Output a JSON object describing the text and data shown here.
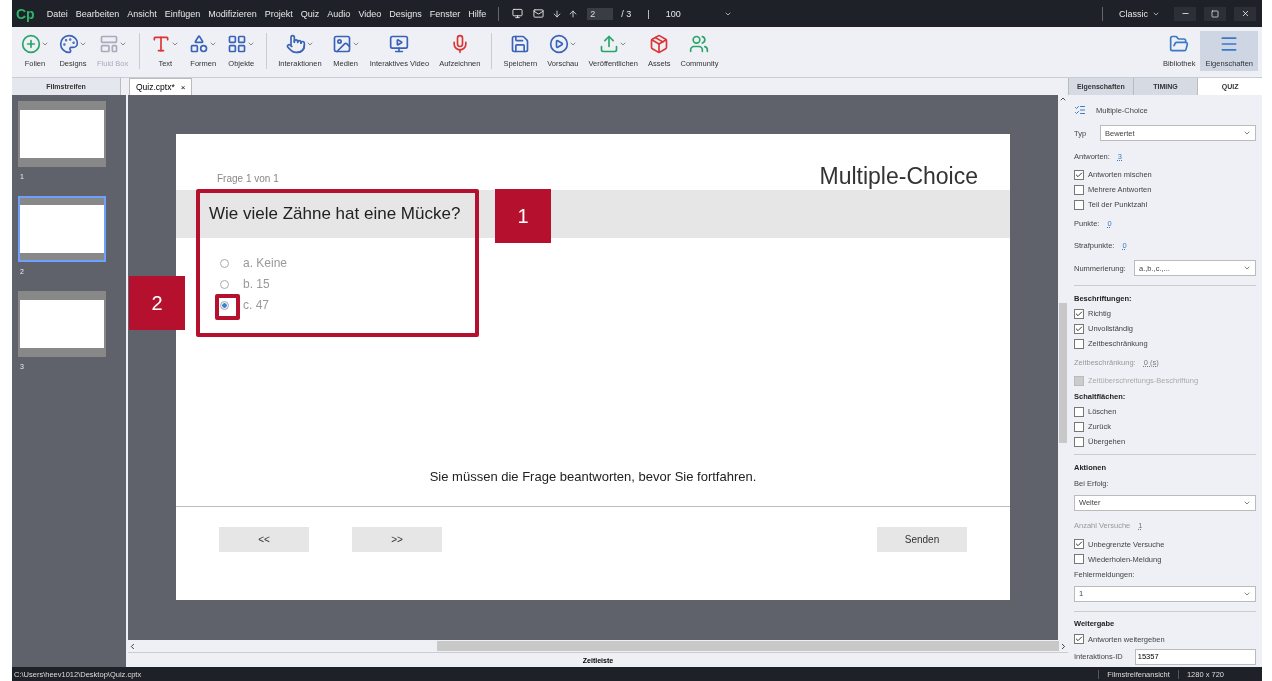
{
  "app": {
    "logo": "Cp",
    "menu": [
      "Datei",
      "Bearbeiten",
      "Ansicht",
      "Einfügen",
      "Modifizieren",
      "Projekt",
      "Quiz",
      "Audio",
      "Video",
      "Designs",
      "Fenster",
      "Hilfe"
    ],
    "page": "2",
    "page_total": "/ 3",
    "page_sep": "|",
    "zoom": "100",
    "workspace": "Classic"
  },
  "toolbar": [
    {
      "kind": "tool",
      "label": "Folien",
      "has_menu": true,
      "disabled": false
    },
    {
      "kind": "tool",
      "label": "Designs",
      "has_menu": true,
      "disabled": false
    },
    {
      "kind": "tool",
      "label": "Fluid Box",
      "has_menu": true,
      "disabled": true
    },
    {
      "kind": "separator"
    },
    {
      "kind": "tool",
      "label": "Text",
      "has_menu": true,
      "disabled": false
    },
    {
      "kind": "tool",
      "label": "Formen",
      "has_menu": true,
      "disabled": false
    },
    {
      "kind": "tool",
      "label": "Objekte",
      "has_menu": true,
      "disabled": false
    },
    {
      "kind": "separator"
    },
    {
      "kind": "tool",
      "label": "Interaktionen",
      "has_menu": true,
      "disabled": false
    },
    {
      "kind": "tool",
      "label": "Medien",
      "has_menu": true,
      "disabled": false
    },
    {
      "kind": "tool",
      "label": "Interaktives Video",
      "has_menu": false,
      "disabled": false
    },
    {
      "kind": "tool",
      "label": "Aufzeichnen",
      "has_menu": false,
      "disabled": false
    },
    {
      "kind": "separator"
    },
    {
      "kind": "tool",
      "label": "Speichern",
      "has_menu": false,
      "disabled": false
    },
    {
      "kind": "tool",
      "label": "Vorschau",
      "has_menu": true,
      "disabled": false
    },
    {
      "kind": "tool",
      "label": "Veröffentlichen",
      "has_menu": true,
      "disabled": false
    },
    {
      "kind": "tool",
      "label": "Assets",
      "has_menu": false,
      "disabled": false
    },
    {
      "kind": "tool",
      "label": "Community",
      "has_menu": false,
      "disabled": false
    }
  ],
  "toolbar_right": [
    {
      "label": "Bibliothek",
      "selected": false
    },
    {
      "label": "Eigenschaften",
      "selected": true
    }
  ],
  "filmstrip": {
    "title": "Filmstreifen",
    "slides": [
      {
        "number": "1",
        "selected": false
      },
      {
        "number": "2",
        "selected": true
      },
      {
        "number": "3",
        "selected": false
      }
    ]
  },
  "document_tab": {
    "title": "Quiz.cptx*",
    "close": "×"
  },
  "slide": {
    "counter": "Frage 1 von 1",
    "title": "Multiple-Choice",
    "question": "Wie viele Zähne hat eine Mücke?",
    "answers": [
      {
        "text": "a. Keine",
        "selected": false
      },
      {
        "text": "b. 15",
        "selected": false
      },
      {
        "text": "c. 47",
        "selected": true
      }
    ],
    "message": "Sie müssen die Frage beantworten, bevor Sie fortfahren.",
    "buttons": [
      "<<",
      ">>",
      "Senden"
    ]
  },
  "annotations": [
    {
      "label": "1"
    },
    {
      "label": "2"
    }
  ],
  "panel": {
    "tabs": [
      {
        "label": "Eigenschaften",
        "selected": false
      },
      {
        "label": "TIMING",
        "selected": false
      },
      {
        "label": "QUIZ",
        "selected": true
      }
    ],
    "rows": [
      {
        "kind": "title",
        "label": "Multiple-Choice"
      },
      {
        "kind": "select",
        "label": "Typ",
        "value": "Bewertet"
      },
      {
        "kind": "number",
        "label": "Antworten:",
        "value": "3",
        "disabled": false
      },
      {
        "kind": "check",
        "label": "Antworten mischen",
        "checked": true,
        "disabled": false
      },
      {
        "kind": "check",
        "label": "Mehrere Antworten",
        "checked": false,
        "disabled": false
      },
      {
        "kind": "check",
        "label": "Teil der Punktzahl",
        "checked": false,
        "disabled": false
      },
      {
        "kind": "number",
        "label": "Punkte:",
        "value": "0",
        "disabled": false
      },
      {
        "kind": "number",
        "label": "Strafpunkte:",
        "value": "0",
        "disabled": false
      },
      {
        "kind": "select",
        "label": "Nummerierung:",
        "value": "a.,b.,c.,..."
      },
      {
        "kind": "divider"
      },
      {
        "kind": "heading",
        "label": "Beschriftungen:"
      },
      {
        "kind": "check",
        "label": "Richtig",
        "checked": true,
        "disabled": false
      },
      {
        "kind": "check",
        "label": "Unvollständig",
        "checked": true,
        "disabled": false
      },
      {
        "kind": "check",
        "label": "Zeitbeschränkung",
        "checked": false,
        "disabled": false
      },
      {
        "kind": "number",
        "label": "Zeitbeschränkung:",
        "value": "0 (s)",
        "disabled": true
      },
      {
        "kind": "check",
        "label": "Zeitüberschreitungs-Beschriftung",
        "checked": false,
        "disabled": true
      },
      {
        "kind": "heading",
        "label": "Schaltflächen:"
      },
      {
        "kind": "check",
        "label": "Löschen",
        "checked": false,
        "disabled": false
      },
      {
        "kind": "check",
        "label": "Zurück",
        "checked": false,
        "disabled": false
      },
      {
        "kind": "check",
        "label": "Übergehen",
        "checked": false,
        "disabled": false
      },
      {
        "kind": "divider"
      },
      {
        "kind": "heading",
        "label": "Aktionen"
      },
      {
        "kind": "label",
        "label": "Bei Erfolg:"
      },
      {
        "kind": "select",
        "value": "Weiter"
      },
      {
        "kind": "number",
        "label": "Anzahl Versuche",
        "value": "1",
        "disabled": true
      },
      {
        "kind": "check",
        "label": "Unbegrenzte Versuche",
        "checked": true,
        "disabled": false
      },
      {
        "kind": "check",
        "label": "Wiederholen-Meldung",
        "checked": false,
        "disabled": false
      },
      {
        "kind": "label",
        "label": "Fehlermeldungen:"
      },
      {
        "kind": "select",
        "value": "1"
      },
      {
        "kind": "divider"
      },
      {
        "kind": "heading",
        "label": "Weitergabe"
      },
      {
        "kind": "check",
        "label": "Antworten weitergeben",
        "checked": true,
        "disabled": false
      },
      {
        "kind": "input",
        "label": "Interaktions-ID",
        "value": "15357"
      }
    ]
  },
  "timeline": {
    "title": "Zeitleiste"
  },
  "status_bar": {
    "path": "C:\\Users\\heev1012\\Desktop\\Quiz.cptx",
    "view": "Filmstreifenansicht",
    "size": "1280 x 720"
  }
}
